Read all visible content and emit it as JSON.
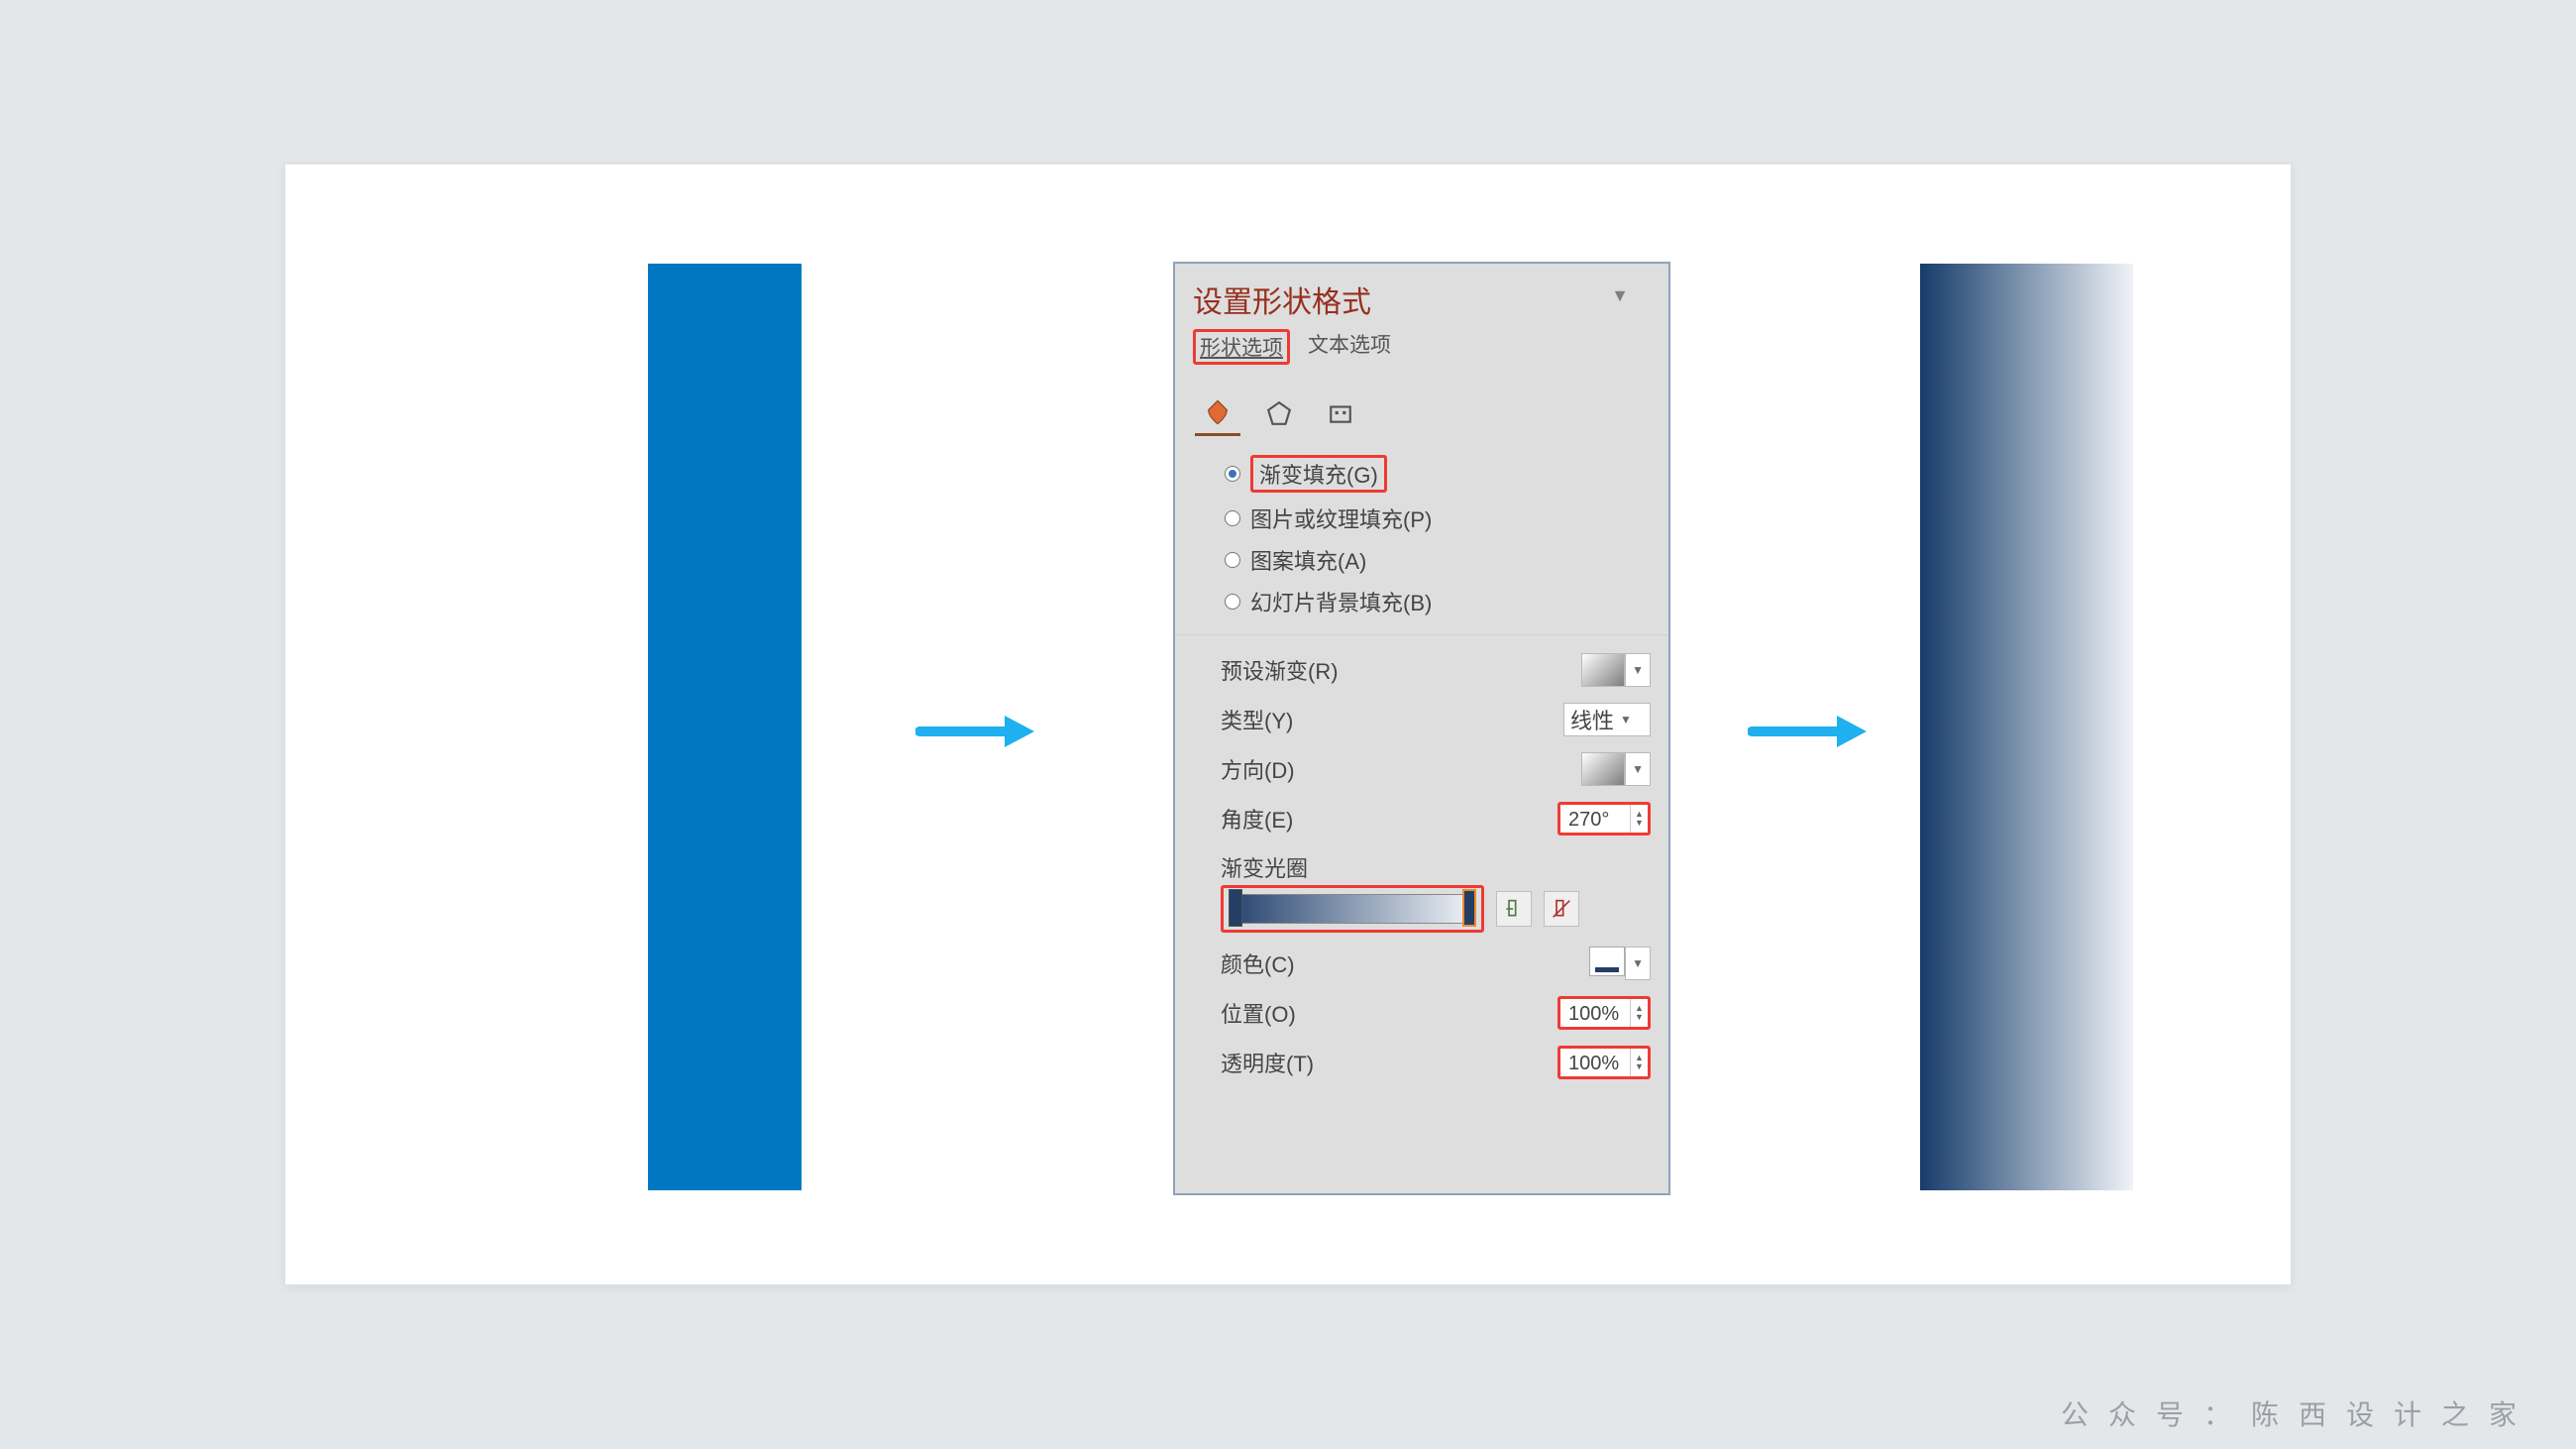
{
  "panel": {
    "title": "设置形状格式",
    "tabs": {
      "shape": "形状选项",
      "text": "文本选项"
    },
    "fill": {
      "gradient": "渐变填充(G)",
      "picture": "图片或纹理填充(P)",
      "pattern": "图案填充(A)",
      "slidebg": "幻灯片背景填充(B)"
    },
    "labels": {
      "preset": "预设渐变(R)",
      "type": "类型(Y)",
      "typeValue": "线性",
      "direction": "方向(D)",
      "angle": "角度(E)",
      "stops": "渐变光圈",
      "color": "颜色(C)",
      "position": "位置(O)",
      "transparency": "透明度(T)"
    },
    "values": {
      "angle": "270°",
      "position": "100%",
      "transparency": "100%"
    }
  },
  "colors": {
    "solid": "#0077c0",
    "gradStart": "#163c6b",
    "gradEnd": "#f0f3f7",
    "arrow": "#1fb0f0",
    "highlight": "#ef3a34"
  },
  "watermark": "公众号：陈西设计之家"
}
